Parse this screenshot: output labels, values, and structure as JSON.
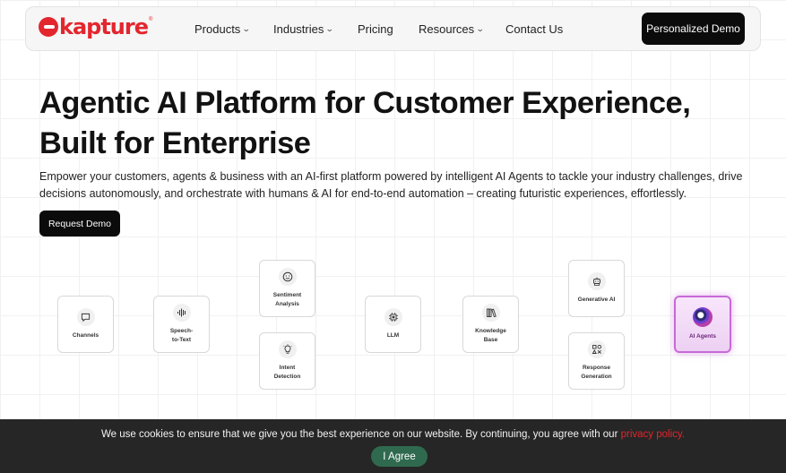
{
  "brand": {
    "name": "kapture",
    "trademark": "®"
  },
  "nav": {
    "items": [
      {
        "label": "Products",
        "has_dropdown": true
      },
      {
        "label": "Industries",
        "has_dropdown": true
      },
      {
        "label": "Pricing",
        "has_dropdown": false
      },
      {
        "label": "Resources",
        "has_dropdown": true
      },
      {
        "label": "Contact Us",
        "has_dropdown": false
      }
    ],
    "cta_label": "Personalized Demo"
  },
  "hero": {
    "title_line1": "Agentic AI Platform for Customer Experience,",
    "title_line2": "Built for Enterprise",
    "subtitle": "Empower your customers, agents & business with an AI-first platform powered by intelligent AI Agents to tackle your industry challenges, drive decisions autonomously, and orchestrate with humans & AI for end-to-end automation – creating futuristic experiences, effortlessly.",
    "cta_label": "Request Demo"
  },
  "flow": {
    "cards": [
      {
        "id": "channels",
        "label": "Channels",
        "icon": "chat-bubble-icon"
      },
      {
        "id": "speech",
        "label": "Speech-\nto-Text",
        "icon": "waveform-icon"
      },
      {
        "id": "sentiment",
        "label": "Sentiment\nAnalysis",
        "icon": "smiley-icon"
      },
      {
        "id": "intent",
        "label": "Intent\nDetection",
        "icon": "lightbulb-icon"
      },
      {
        "id": "llm",
        "label": "LLM",
        "icon": "chip-icon"
      },
      {
        "id": "knowledge",
        "label": "Knowledge\nBase",
        "icon": "books-icon"
      },
      {
        "id": "genai",
        "label": "Generative AI",
        "icon": "robot-icon"
      },
      {
        "id": "response",
        "label": "Response\nGeneration",
        "icon": "grid-icon"
      },
      {
        "id": "agents",
        "label": "AI Agents",
        "icon": "ai-orb-icon"
      }
    ]
  },
  "cookie": {
    "text": "We use cookies to ensure that we give you the best experience on our website. By continuing, you agree with our ",
    "link_label": "privacy policy.",
    "agree_label": "I Agree"
  },
  "colors": {
    "brand_red": "#e3262e",
    "dark": "#0b0b0b",
    "agree_green": "#2f6a4f",
    "ai_card_border": "#c86ad8"
  }
}
